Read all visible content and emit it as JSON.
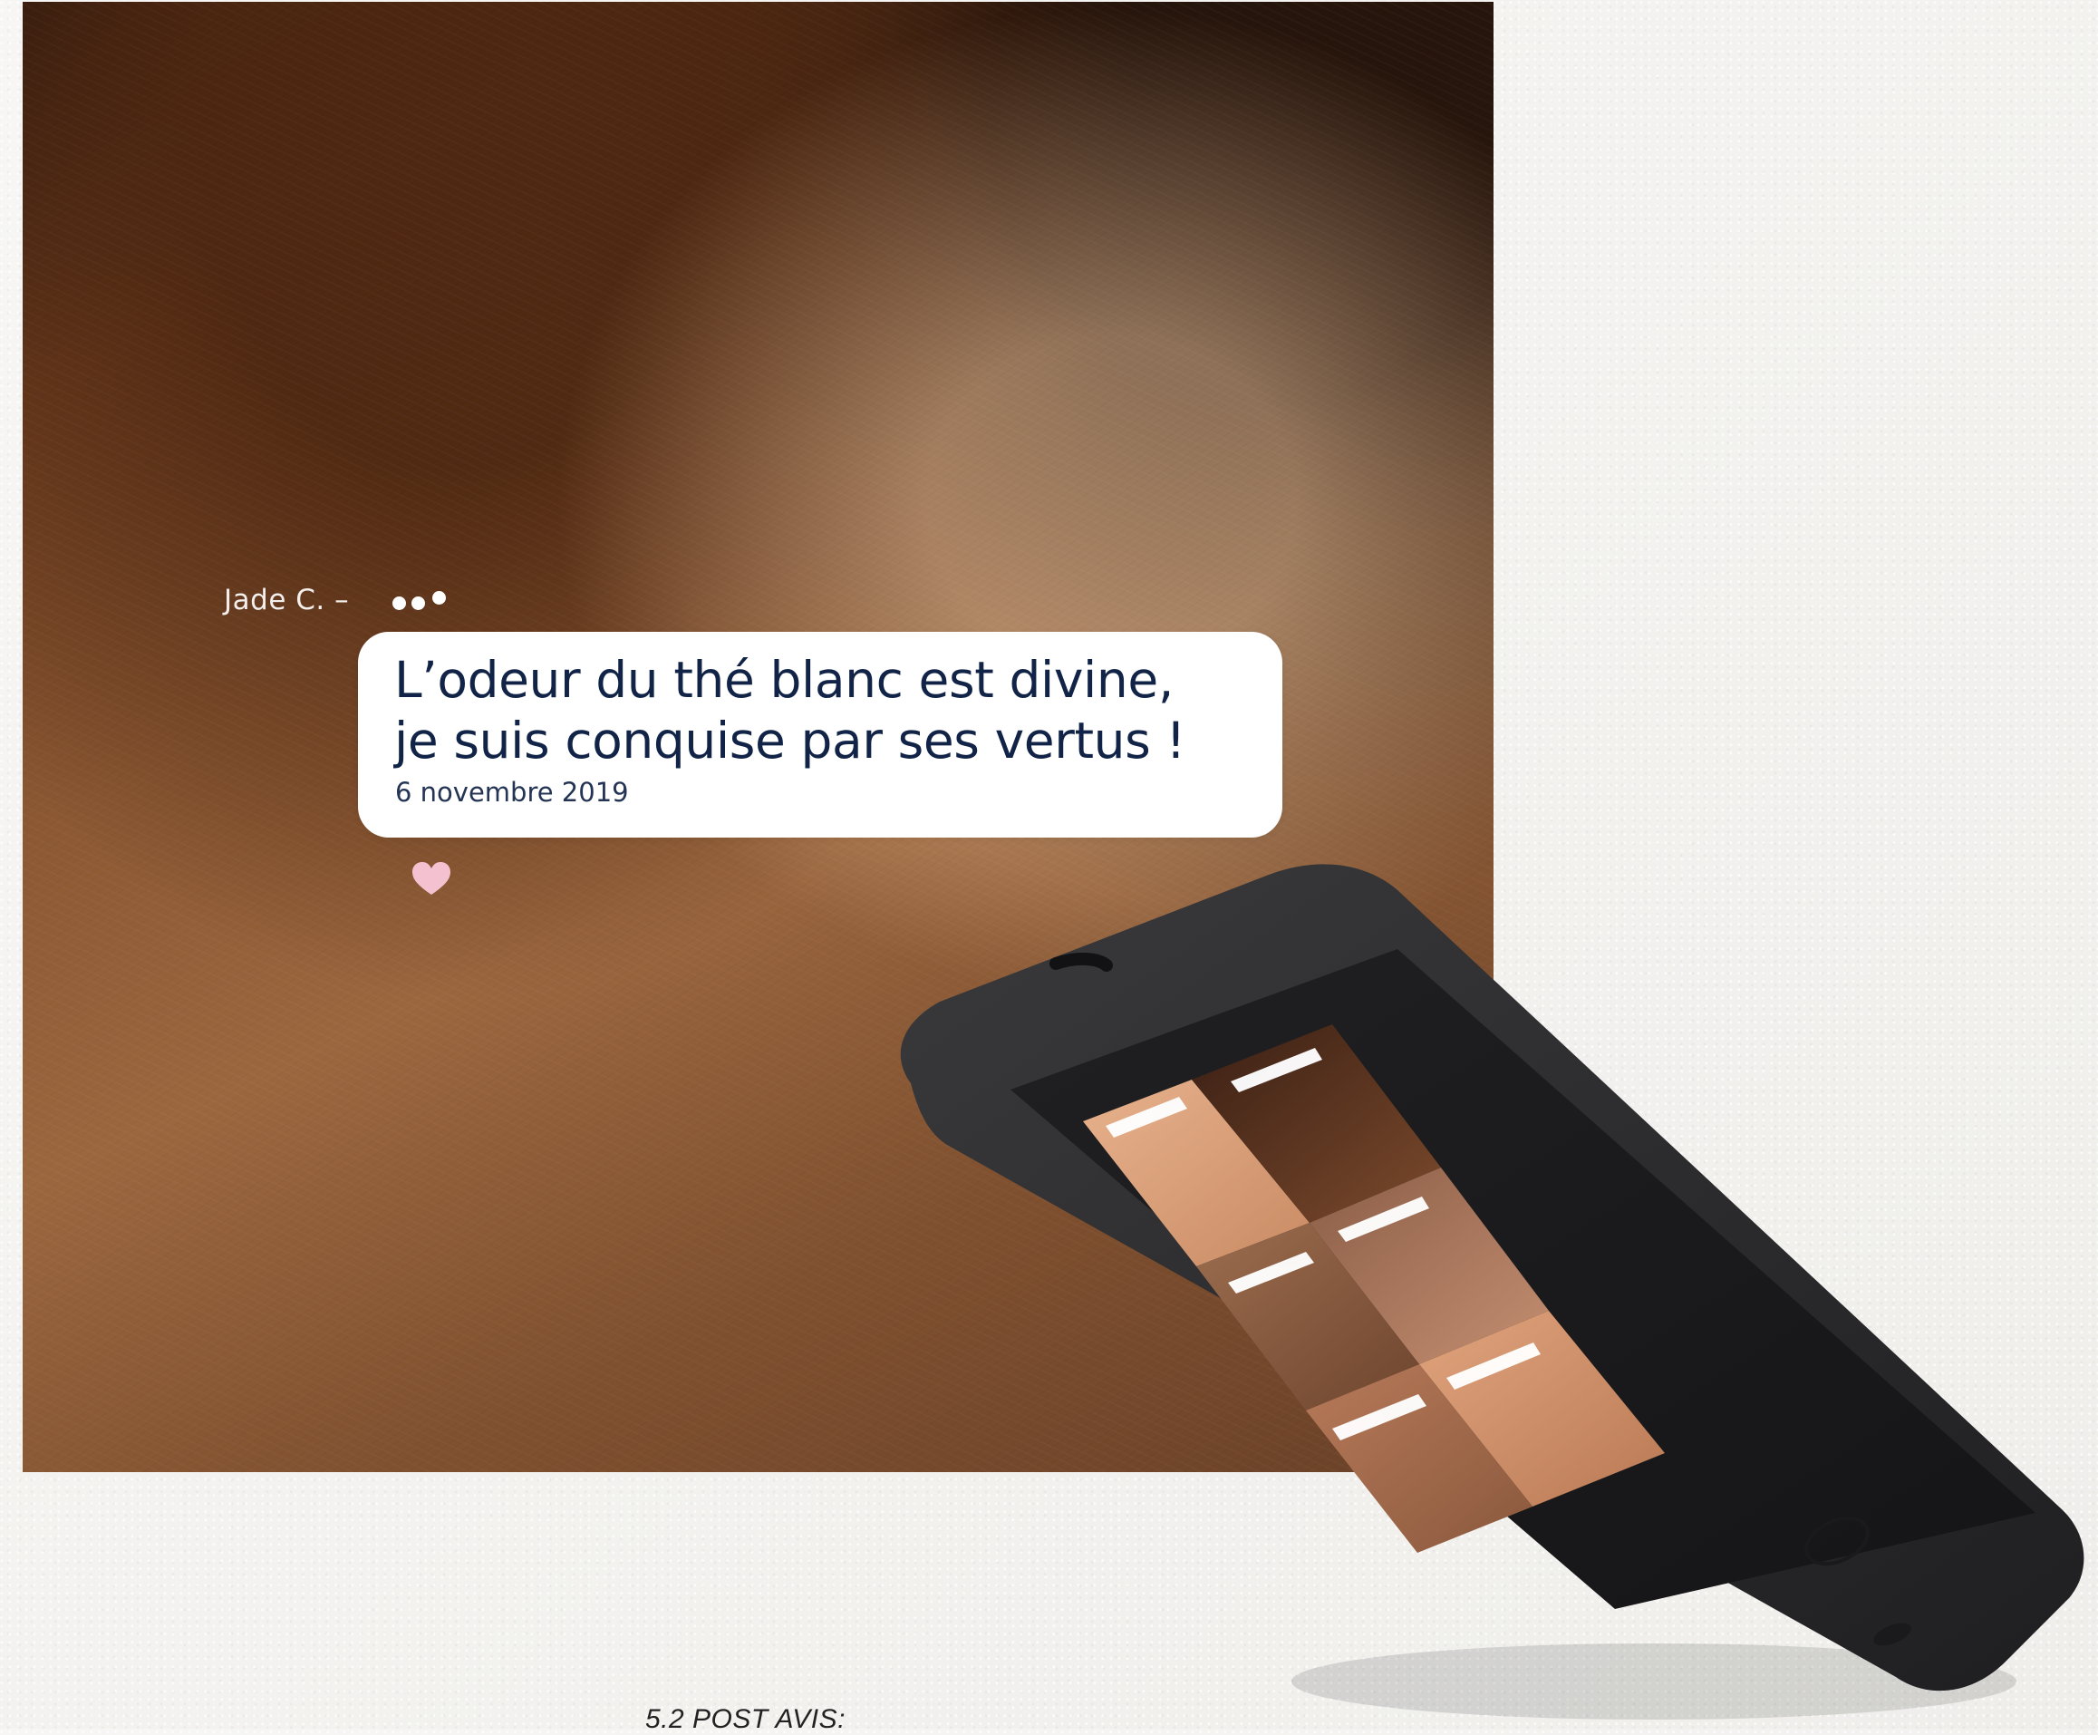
{
  "review": {
    "author": "Jade C. –",
    "text": "L’odeur du thé blanc est divine,\nje suis conquise par ses vertus !",
    "date": "6 novembre 2019"
  },
  "colors": {
    "text_primary": "#112346",
    "text_secondary": "#243455",
    "bubble_bg": "#ffffff",
    "heart": "#f4c1d1",
    "phone_body": "#2c2c2e"
  },
  "icons": {
    "dots": "more-dots-icon",
    "heart": "heart-icon"
  },
  "caption": {
    "label": "5.2 POST AVIS:"
  }
}
